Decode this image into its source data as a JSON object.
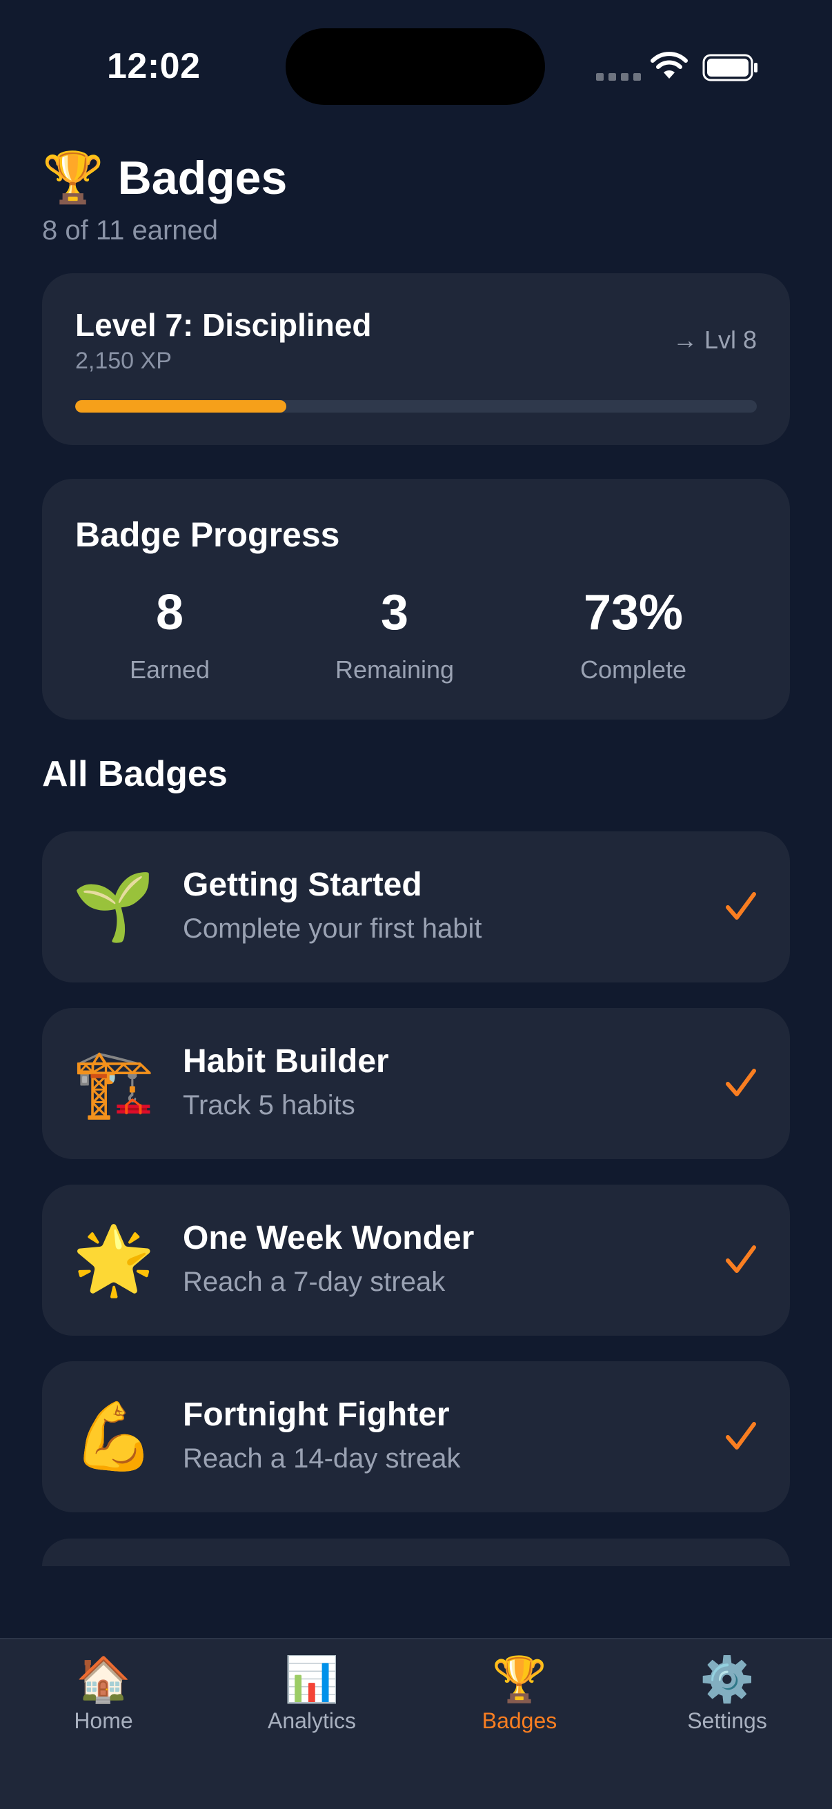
{
  "status": {
    "time": "12:02"
  },
  "header": {
    "icon": "🏆",
    "title": "Badges",
    "subtitle": "8 of 11 earned"
  },
  "level": {
    "title": "Level 7: Disciplined",
    "xp": "2,150 XP",
    "next": "→ Lvl 8",
    "progress_fraction": 0.31,
    "progress_color": "#f6a01a"
  },
  "stats": {
    "heading": "Badge Progress",
    "earned_value": "8",
    "earned_label": "Earned",
    "remaining_value": "3",
    "remaining_label": "Remaining",
    "complete_value": "73%",
    "complete_label": "Complete"
  },
  "section": {
    "heading": "All Badges"
  },
  "badges": [
    {
      "icon": "🌱",
      "title": "Getting Started",
      "desc": "Complete your first habit",
      "earned": true
    },
    {
      "icon": "🏗️",
      "title": "Habit Builder",
      "desc": "Track 5 habits",
      "earned": true
    },
    {
      "icon": "🌟",
      "title": "One Week Wonder",
      "desc": "Reach a 7-day streak",
      "earned": true
    },
    {
      "icon": "💪",
      "title": "Fortnight Fighter",
      "desc": "Reach a 14-day streak",
      "earned": true
    }
  ],
  "colors": {
    "accent": "#f97e21",
    "background": "#111a2e",
    "card": "#1f2739"
  },
  "tabs": [
    {
      "icon": "🏠",
      "label": "Home"
    },
    {
      "icon": "📊",
      "label": "Analytics"
    },
    {
      "icon": "🏆",
      "label": "Badges",
      "active": true
    },
    {
      "icon": "⚙️",
      "label": "Settings"
    }
  ]
}
